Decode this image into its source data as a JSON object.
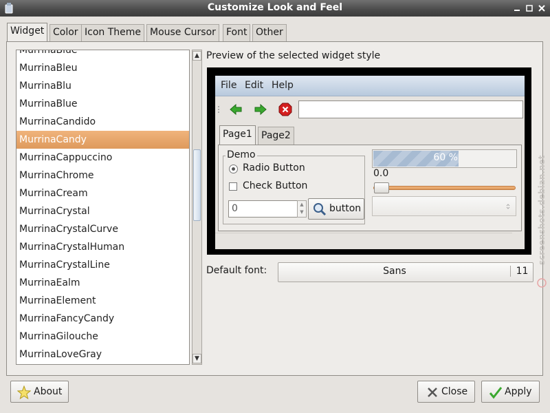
{
  "window": {
    "title": "Customize Look and Feel"
  },
  "tabs": [
    "Widget",
    "Color",
    "Icon Theme",
    "Mouse Cursor",
    "Font",
    "Other"
  ],
  "theme_list": {
    "items": [
      "MurrinaBlue",
      "MurrinaBleu",
      "MurrinaBlu",
      "MurrinaBlue",
      "MurrinaCandido",
      "MurrinaCandy",
      "MurrinaCappuccino",
      "MurrinaChrome",
      "MurrinaCream",
      "MurrinaCrystal",
      "MurrinaCrystalCurve",
      "MurrinaCrystalHuman",
      "MurrinaCrystalLine",
      "MurrinaEalm",
      "MurrinaElement",
      "MurrinaFancyCandy",
      "MurrinaGilouche",
      "MurrinaLoveGray"
    ],
    "selected": "MurrinaCandy"
  },
  "preview": {
    "label": "Preview of the selected widget style",
    "menu": [
      "File",
      "Edit",
      "Help"
    ],
    "tabs": [
      "Page1",
      "Page2"
    ],
    "demo_label": "Demo",
    "radio_label": "Radio Button",
    "check_label": "Check Button",
    "spin_value": "0",
    "button_label": "button",
    "progress_value": 60,
    "progress_text": "60 %",
    "scale_value": "0.0"
  },
  "font": {
    "label": "Default font:",
    "name": "Sans",
    "size": "11"
  },
  "buttons": {
    "about": "About",
    "close": "Close",
    "apply": "Apply"
  },
  "watermark": "screenshots.debian.net",
  "colors": {
    "selection": "#e49f60",
    "menubar": "#c8d6e6",
    "accent_green": "#3aa82f",
    "stop_red": "#d41f1f"
  }
}
